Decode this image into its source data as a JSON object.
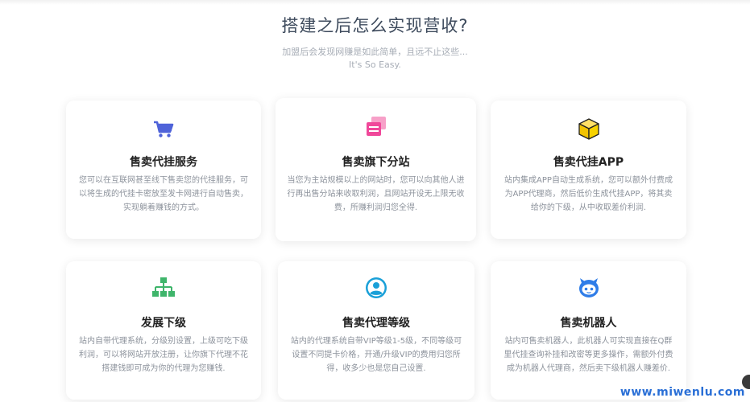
{
  "header": {
    "title": "搭建之后怎么实现营收?",
    "subtitle_line1": "加盟后会发现网赚是如此简单，且远不止这些...",
    "subtitle_line2": "It's So Easy."
  },
  "cards": [
    {
      "title": "售卖代挂服务",
      "icon": "shopping-cart-icon",
      "desc": "您可以在互联网甚至线下售卖您的代挂服务，可以将生成的代挂卡密放至发卡网进行自动售卖，实现躺着赚钱的方式。"
    },
    {
      "title": "售卖旗下分站",
      "icon": "layers-icon",
      "desc": "当您为主站规模以上的网站时，您可以向其他人进行再出售分站来收取利润，且网站开设无上限无收费，所赚利润归您全得."
    },
    {
      "title": "售卖代挂APP",
      "icon": "box-icon",
      "desc": "站内集成APP自动生成系统，您可以额外付费成为APP代理商，然后低价生成代挂APP，将其卖给你的下级，从中收取差价利润."
    },
    {
      "title": "发展下级",
      "icon": "org-chart-icon",
      "desc": "站内自带代理系统，分级别设置，上级可吃下级利润，可以将网站开放注册，让你旗下代理不花搭建钱即可成为你的代理为您赚钱."
    },
    {
      "title": "售卖代理等级",
      "icon": "user-circle-icon",
      "desc": "站内的代理系统自带VIP等级1-5级，不同等级可设置不同提卡价格，开通/升级VIP的费用归您所得，收多少也是您自己设置."
    },
    {
      "title": "售卖机器人",
      "icon": "robot-icon",
      "desc": "站内可售卖机器人，此机器人可实现直接在Q群里代挂查询补挂和改密等更多操作，需额外付费成为机器人代理商，然后卖下级机器人赚差价."
    }
  ],
  "colors": {
    "cart": "#4f63d9",
    "layers": "#f0489a",
    "box": "#f2c300",
    "org": "#3fb56b",
    "user": "#1aa0d8",
    "robot": "#2f7de8"
  },
  "watermark": "www.miwenlu.com"
}
